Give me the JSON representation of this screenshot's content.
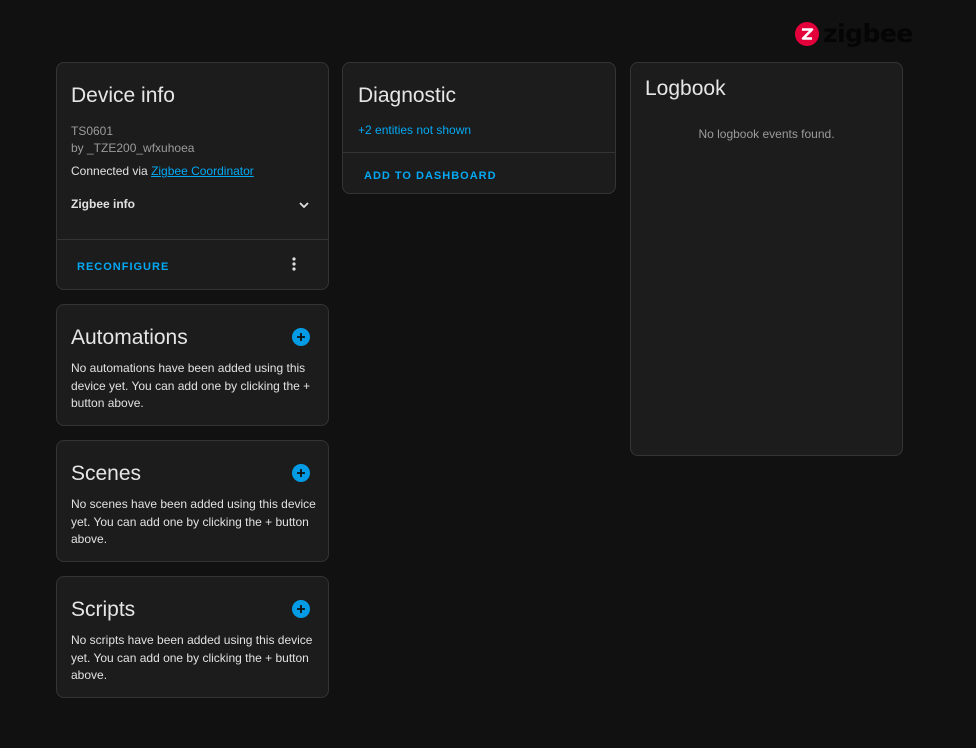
{
  "brand": {
    "logo_text": "zigbee",
    "logo_color": "#e4003b"
  },
  "colors": {
    "accent": "#03a9f4",
    "card_bg": "#1c1c1c",
    "page_bg": "#111111"
  },
  "device_info": {
    "title": "Device info",
    "model": "TS0601",
    "manufacturer": "by _TZE200_wfxuhoea",
    "connected_prefix": "Connected via",
    "connected_link": "Zigbee Coordinator",
    "zigbee_info_label": "Zigbee info",
    "reconfigure_label": "RECONFIGURE",
    "expand_icon": "chevron-down-icon",
    "overflow_icon": "dots-vertical-icon"
  },
  "automations": {
    "title": "Automations",
    "empty_text": "No automations have been added using this device yet. You can add one by clicking the + button above.",
    "add_icon": "plus-circle-icon"
  },
  "scenes": {
    "title": "Scenes",
    "empty_text": "No scenes have been added using this device yet. You can add one by clicking the + button above.",
    "add_icon": "plus-circle-icon"
  },
  "scripts": {
    "title": "Scripts",
    "empty_text": "No scripts have been added using this device yet. You can add one by clicking the + button above.",
    "add_icon": "plus-circle-icon"
  },
  "diagnostic": {
    "title": "Diagnostic",
    "hidden_entities": "+2 entities not shown",
    "add_to_dashboard": "ADD TO DASHBOARD"
  },
  "logbook": {
    "title": "Logbook",
    "empty_text": "No logbook events found."
  }
}
